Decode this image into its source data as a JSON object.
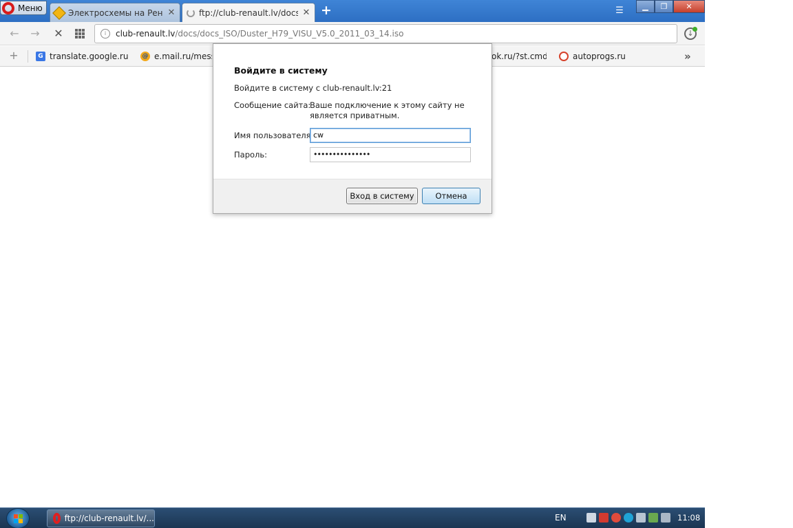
{
  "browser": {
    "menu_label": "Меню",
    "tabs": [
      {
        "title": "Электросхемы на Рено Д",
        "active": false
      },
      {
        "title": "ftp://club-renault.lv/docs/",
        "active": true
      }
    ],
    "new_tab": "+",
    "url_host": "club-renault.lv",
    "url_path": "/docs/docs_ISO/Duster_H79_VISU_V5.0_2011_03_14.iso",
    "bookmarks": [
      {
        "label": "translate.google.ru/?h",
        "icon": "google-translate-icon"
      },
      {
        "label": "e.mail.ru/messa",
        "icon": "mail-ru-icon"
      },
      {
        "label": "ok.ru/?st.cmd=",
        "icon": ""
      },
      {
        "label": "autoprogs.ru",
        "icon": "clock-icon"
      }
    ]
  },
  "dialog": {
    "title": "Войдите в систему",
    "subtitle": "Войдите в систему с club-renault.lv:21",
    "message_label": "Сообщение сайта:",
    "message": "Ваше подключение к этому сайту не является приватным.",
    "username_label": "Имя пользователя:",
    "username_value": "cw",
    "password_label": "Пароль:",
    "password_value": "•••••••••••••••",
    "login_button": "Вход в систему",
    "cancel_button": "Отмена"
  },
  "taskbar": {
    "task_label": "ftp://club-renault.lv/...",
    "lang": "EN",
    "clock": "11:08"
  },
  "colors": {
    "tabstrip": "#2d6fc3",
    "taskbar": "#1b3552",
    "opera_red": "#d81b1b"
  }
}
